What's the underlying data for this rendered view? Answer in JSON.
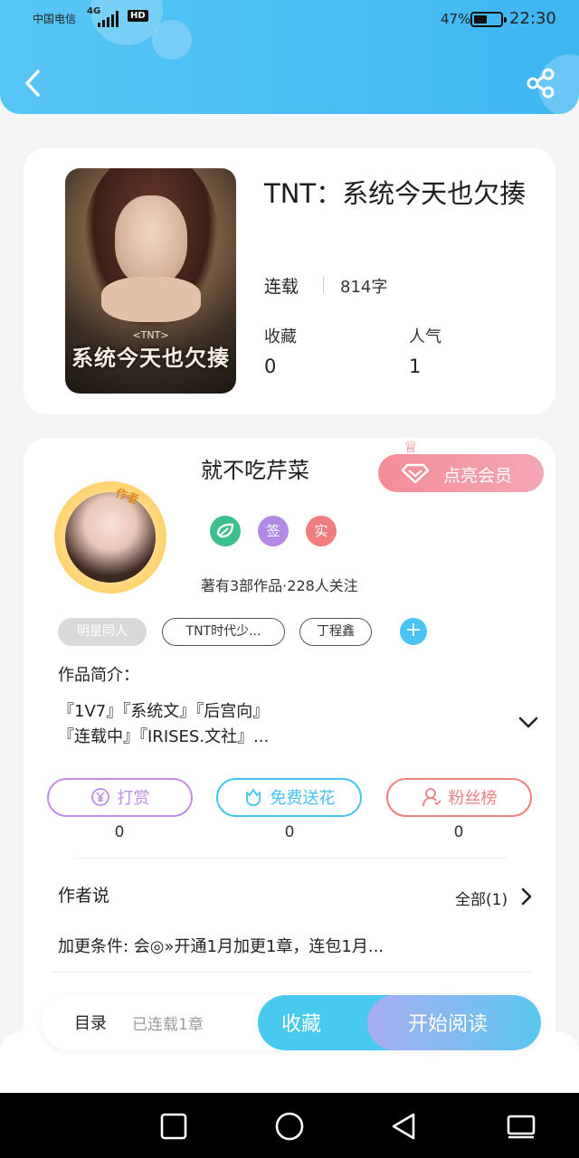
{
  "status_bar": {
    "carrier": "中国电信",
    "network": "4G",
    "hd": "HD",
    "battery_pct": "47%",
    "battery_level": 0.47,
    "time": "22:30"
  },
  "header": {
    "back_icon": "chevron-left-icon",
    "share_icon": "share-icon",
    "accent_color": "#3eb6f2"
  },
  "book": {
    "title": "TNT：系统今天也欠揍",
    "status": "连载",
    "word_count": "814字",
    "cover_tag": "<TNT>",
    "cover_title": "系统今天也欠揍",
    "stats": [
      {
        "label": "收藏",
        "value": "0"
      },
      {
        "label": "人气",
        "value": "1"
      }
    ]
  },
  "author": {
    "name": "就不吃芹菜",
    "badge": "作者",
    "vip_button": "点亮会员",
    "badges": [
      {
        "text": "",
        "icon": "leaf-icon",
        "color": "#3dbf8f"
      },
      {
        "text": "签",
        "icon": "",
        "color": "#b18ae6"
      },
      {
        "text": "实",
        "icon": "",
        "color": "#f07d80"
      }
    ],
    "stats_text": "著有3部作品·228人关注"
  },
  "tags": [
    "明星同人",
    "TNT时代少...",
    "丁程鑫"
  ],
  "intro": {
    "label": "作品简介：",
    "line1": "『1V7』『系统文』『后宫向』",
    "line2": "『连载中』『IRISES.文社』..."
  },
  "actions": [
    {
      "label": "打赏",
      "icon": "yen-icon",
      "count": "0",
      "color": "#c08ee8"
    },
    {
      "label": "免费送花",
      "icon": "flower-icon",
      "count": "0",
      "color": "#46c4ef"
    },
    {
      "label": "粉丝榜",
      "icon": "user-icon",
      "count": "0",
      "color": "#f07f82"
    }
  ],
  "author_say": {
    "title": "作者说",
    "all": "全部(1)",
    "text": "加更条件: 会◎»开通1月加更1章，连包1月..."
  },
  "bottom_bar": {
    "toc": "目录",
    "toc_status": "已连载1章",
    "collect": "收藏",
    "read": "开始阅读"
  },
  "nav": [
    "square-icon",
    "circle-icon",
    "triangle-back-icon",
    "recent-apps-icon"
  ]
}
